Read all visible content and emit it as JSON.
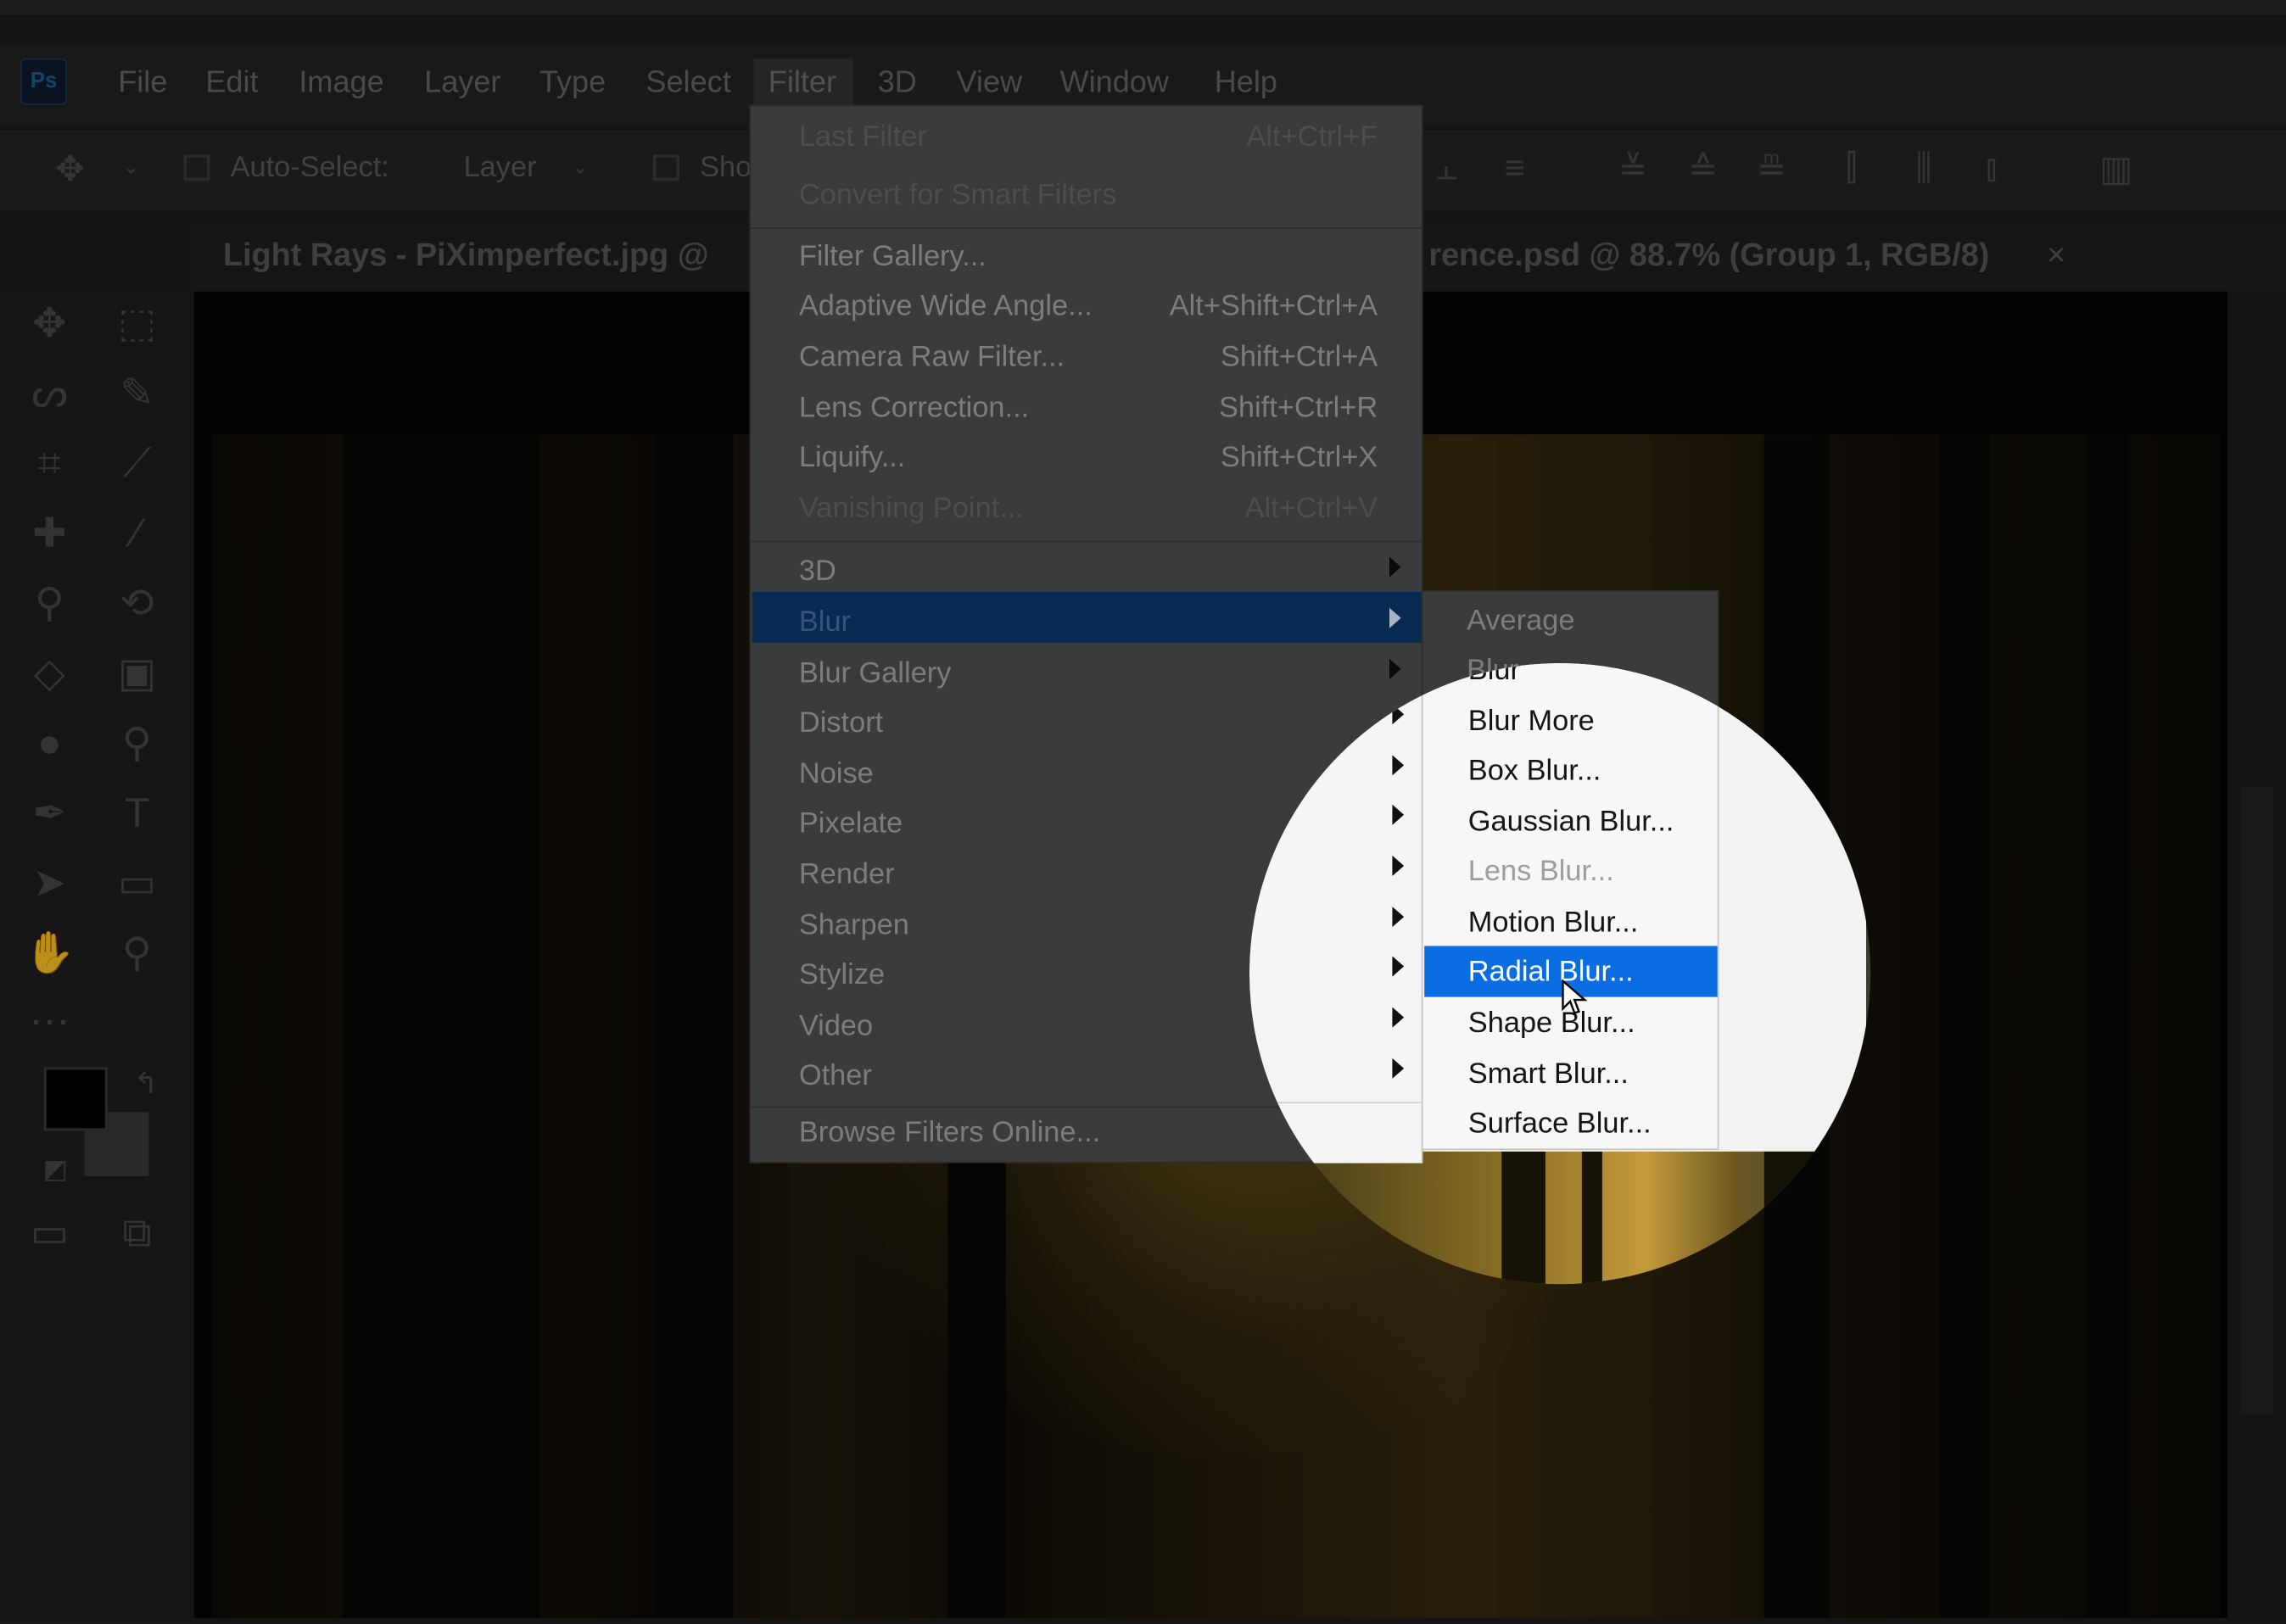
{
  "app": {
    "logo_text": "Ps",
    "menu": [
      "File",
      "Edit",
      "Image",
      "Layer",
      "Type",
      "Select",
      "Filter",
      "3D",
      "View",
      "Window",
      "Help"
    ],
    "active_menu": "Filter"
  },
  "options_bar": {
    "move_icon": "move-icon",
    "auto_select_label": "Auto-Select:",
    "auto_select_value": "Layer",
    "show_label": "Sho"
  },
  "tabs": [
    {
      "label": "Light Rays - PiXimperfect.jpg @"
    },
    {
      "label": "rence.psd @ 88.7% (Group 1, RGB/8)"
    }
  ],
  "filter_menu": {
    "items": [
      {
        "label": "Last Filter",
        "shortcut": "Alt+Ctrl+F",
        "disabled": true
      },
      {
        "label": "Convert for Smart Filters",
        "disabled": true
      },
      {
        "label": "Filter Gallery..."
      },
      {
        "label": "Adaptive Wide Angle...",
        "shortcut": "Alt+Shift+Ctrl+A"
      },
      {
        "label": "Camera Raw Filter...",
        "shortcut": "Shift+Ctrl+A"
      },
      {
        "label": "Lens Correction...",
        "shortcut": "Shift+Ctrl+R"
      },
      {
        "label": "Liquify...",
        "shortcut": "Shift+Ctrl+X"
      },
      {
        "label": "Vanishing Point...",
        "shortcut": "Alt+Ctrl+V",
        "disabled": true
      },
      {
        "label": "3D",
        "submenu": true
      },
      {
        "label": "Blur",
        "submenu": true,
        "highlighted": true
      },
      {
        "label": "Blur Gallery",
        "submenu": true
      },
      {
        "label": "Distort",
        "submenu": true
      },
      {
        "label": "Noise",
        "submenu": true
      },
      {
        "label": "Pixelate",
        "submenu": true
      },
      {
        "label": "Render",
        "submenu": true
      },
      {
        "label": "Sharpen",
        "submenu": true
      },
      {
        "label": "Stylize",
        "submenu": true
      },
      {
        "label": "Video",
        "submenu": true
      },
      {
        "label": "Other",
        "submenu": true
      },
      {
        "label": "Browse Filters Online..."
      }
    ]
  },
  "blur_submenu": {
    "items": [
      {
        "label": "Average"
      },
      {
        "label": "Blur"
      },
      {
        "label": "Blur More"
      },
      {
        "label": "Box Blur..."
      },
      {
        "label": "Gaussian Blur..."
      },
      {
        "label": "Lens Blur...",
        "disabled": true
      },
      {
        "label": "Motion Blur..."
      },
      {
        "label": "Radial Blur...",
        "highlighted": true
      },
      {
        "label": "Shape Blur..."
      },
      {
        "label": "Smart Blur..."
      },
      {
        "label": "Surface Blur..."
      }
    ]
  },
  "colors": {
    "highlight_blue": "#0a6ee2",
    "menu_bg": "#f5f5f5",
    "app_bg": "#1e1e1e"
  }
}
